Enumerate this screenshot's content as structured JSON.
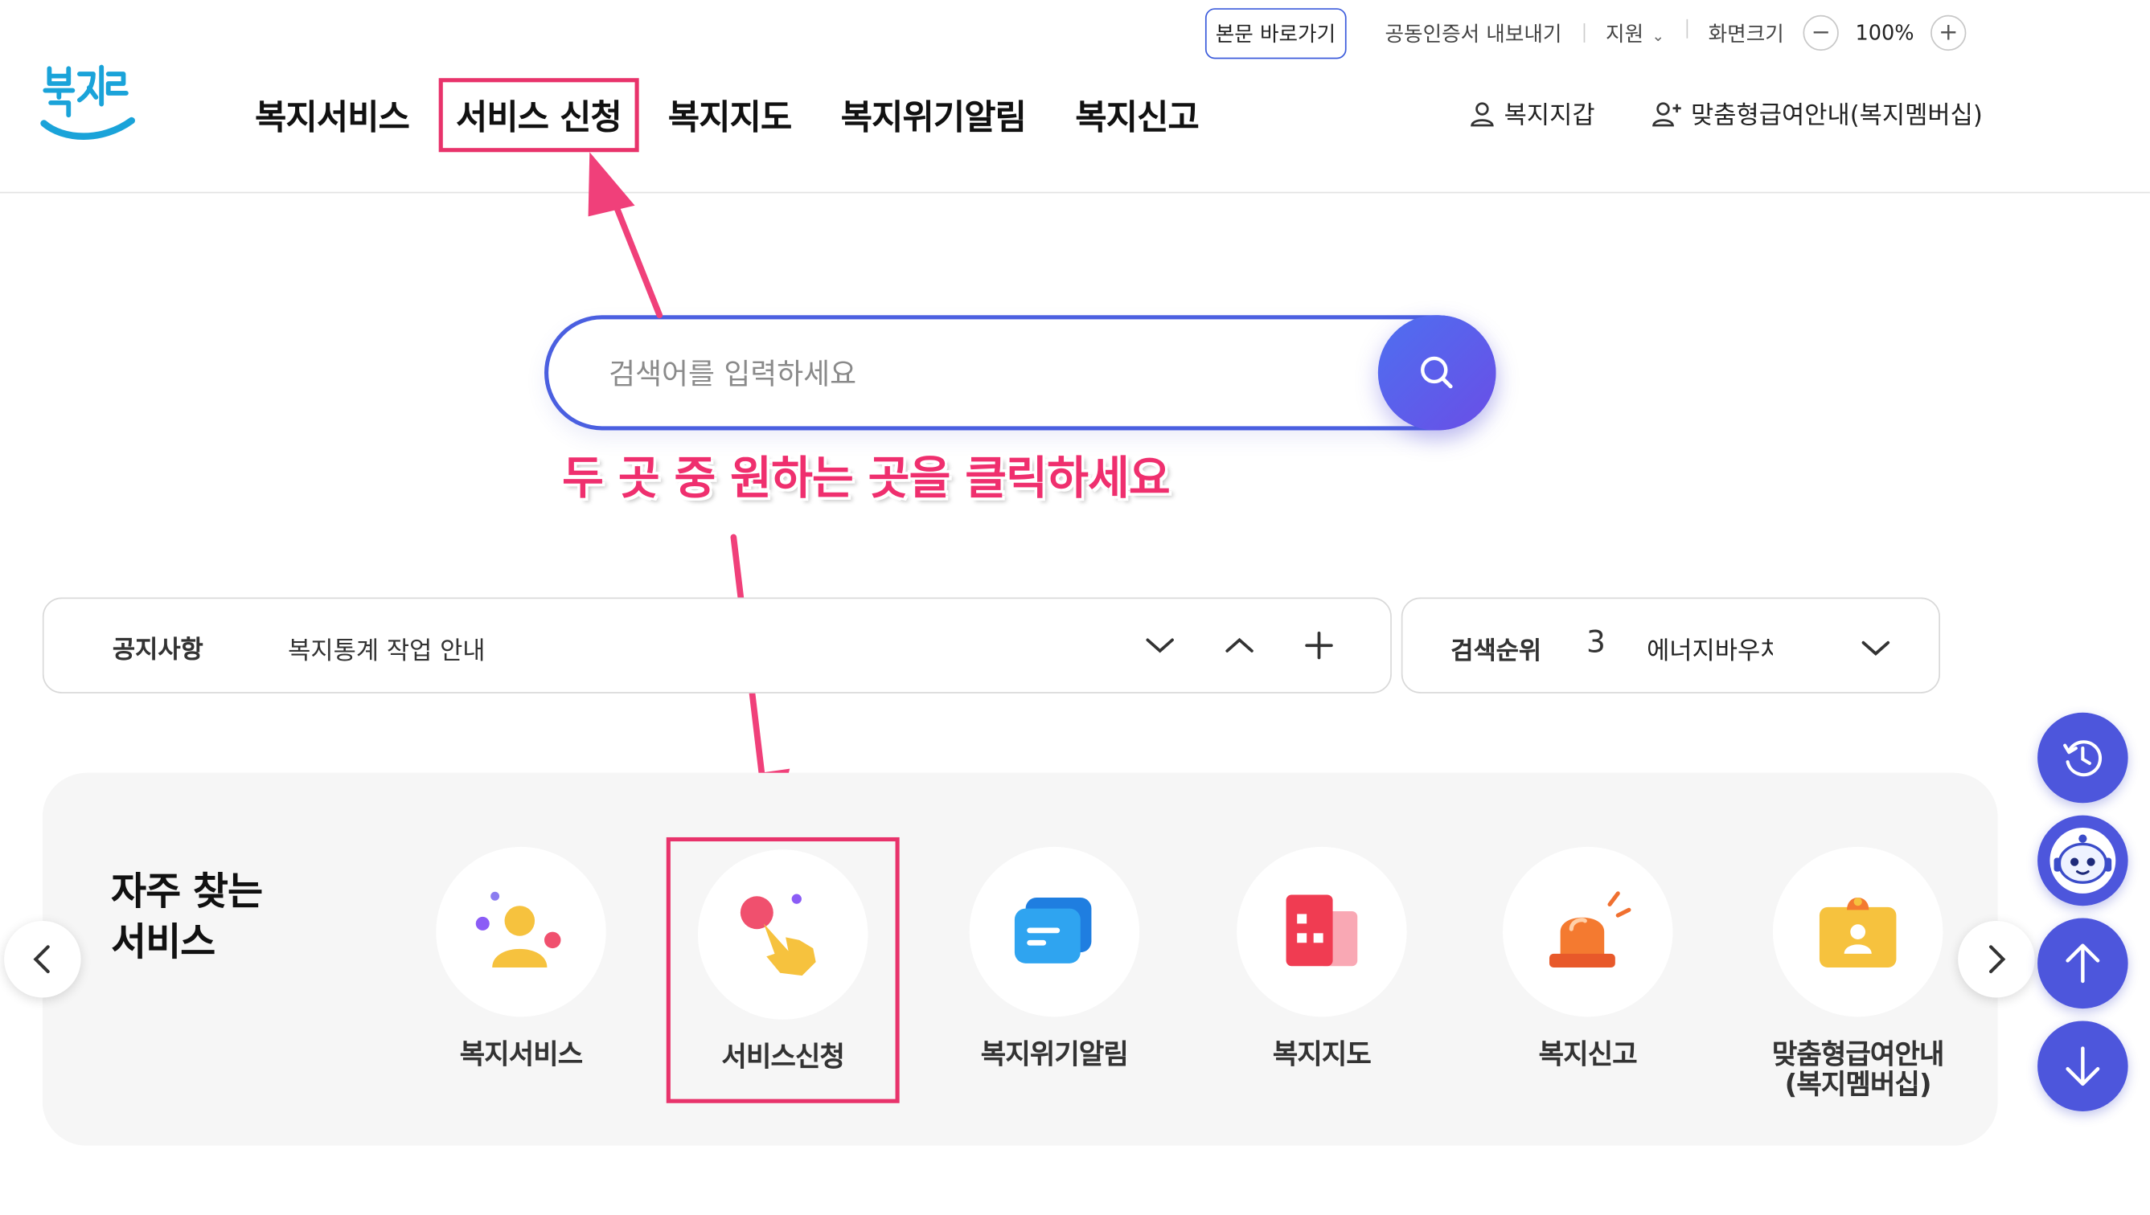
{
  "header": {
    "logo_text": "복지로",
    "util": {
      "skip_link": "본문 바로가기",
      "cert_export": "공동인증서 내보내기",
      "support": "지원",
      "screen_size": "화면크기",
      "zoom_level": "100%"
    },
    "gnb": [
      {
        "label": "복지서비스"
      },
      {
        "label": "서비스 신청"
      },
      {
        "label": "복지지도"
      },
      {
        "label": "복지위기알림"
      },
      {
        "label": "복지신고"
      }
    ],
    "account": {
      "wallet": "복지지갑",
      "membership": "맞춤형급여안내(복지멤버십)"
    }
  },
  "search": {
    "placeholder": "검색어를 입력하세요"
  },
  "annotation": {
    "instruction": "두 곳 중 원하는 곳을 클릭하세요",
    "highlight_color": "#e8336b"
  },
  "notice": {
    "label": "공지사항",
    "text": "복지통계 작업 안내"
  },
  "rank": {
    "label": "검색순위",
    "number": "3",
    "text": "에너지바우처"
  },
  "frequent": {
    "title": "자주 찾는\n서비스",
    "items": [
      {
        "label": "복지서비스",
        "icon": "person-icon"
      },
      {
        "label": "서비스신청",
        "icon": "hand-tap-icon"
      },
      {
        "label": "복지위기알림",
        "icon": "message-icon"
      },
      {
        "label": "복지지도",
        "icon": "map-building-icon"
      },
      {
        "label": "복지신고",
        "icon": "siren-icon"
      },
      {
        "label": "맞춤형급여안내\n(복지멤버십)",
        "icon": "id-card-icon"
      }
    ]
  },
  "colors": {
    "brand_blue": "#4a5fe0",
    "fab_blue": "#4d56dc",
    "accent_pink": "#ef2f6e"
  }
}
